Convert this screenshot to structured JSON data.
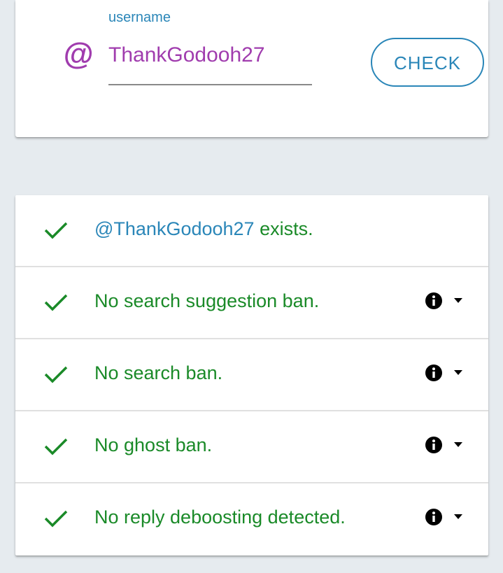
{
  "search": {
    "label": "username",
    "value": "ThankGodooh27",
    "at_symbol": "@",
    "check_label": "CHECK"
  },
  "results": {
    "exists": {
      "handle": "@ThankGodooh27",
      "suffix": " exists."
    },
    "items": [
      {
        "label": "No search suggestion ban."
      },
      {
        "label": "No search ban."
      },
      {
        "label": "No ghost ban."
      },
      {
        "label": "No reply deboosting detected."
      }
    ]
  },
  "icons": {
    "status": "check-icon",
    "info": "info-icon",
    "expand": "caret-down-icon"
  },
  "colors": {
    "accent": "#2a86b8",
    "username": "#a03cae",
    "success": "#1a8a28",
    "background": "#e6ebef"
  }
}
